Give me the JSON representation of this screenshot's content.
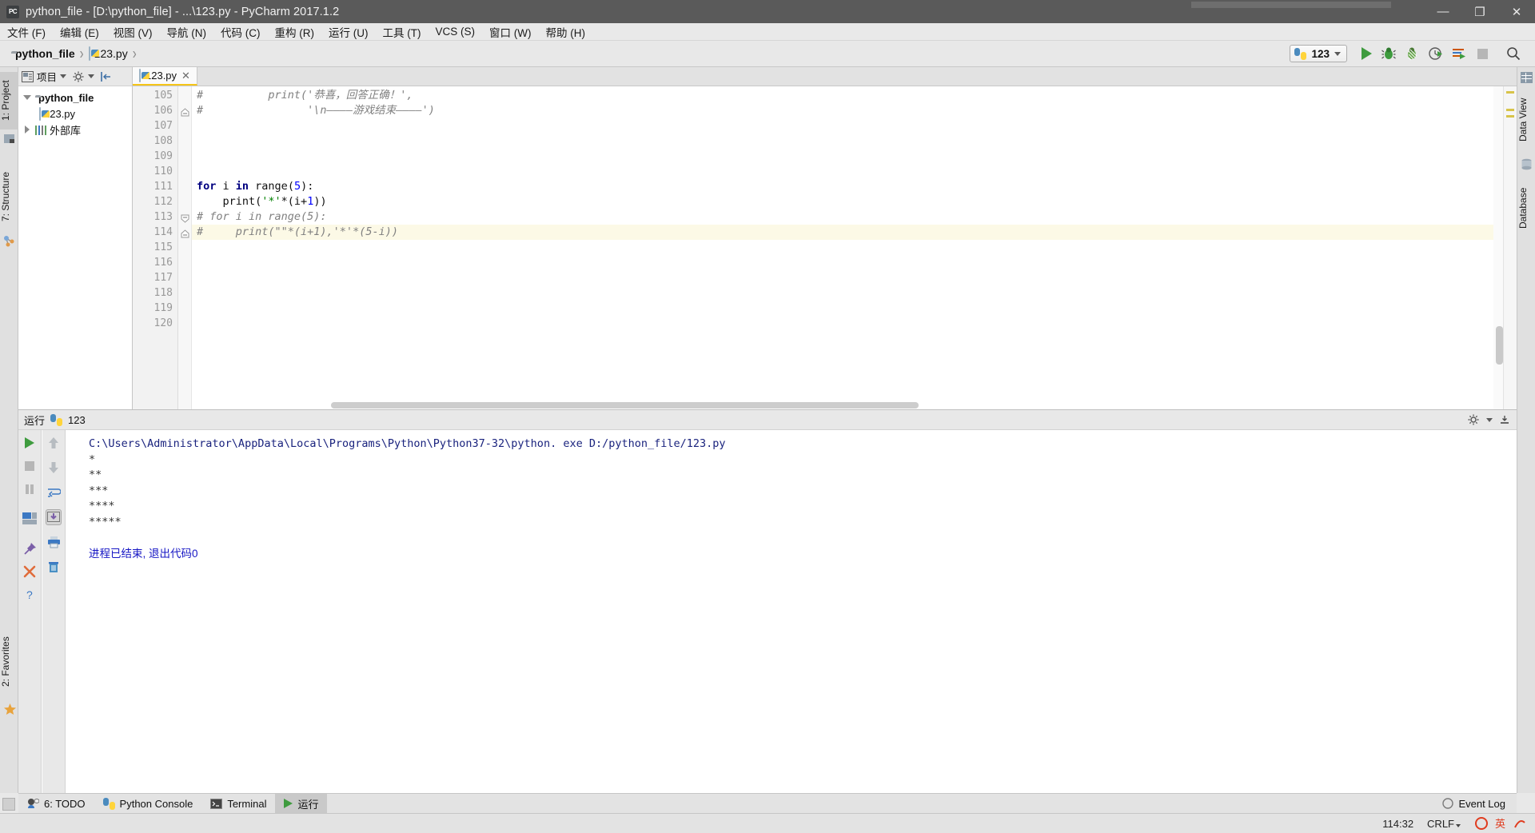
{
  "window": {
    "title": "python_file - [D:\\python_file] - ...\\123.py - PyCharm 2017.1.2",
    "app_icon": "PC",
    "minimize": "—",
    "maximize": "❐",
    "close": "✕"
  },
  "menubar": {
    "items": [
      {
        "label": "文件 (F)"
      },
      {
        "label": "编辑 (E)"
      },
      {
        "label": "视图 (V)"
      },
      {
        "label": "导航 (N)"
      },
      {
        "label": "代码 (C)"
      },
      {
        "label": "重构 (R)"
      },
      {
        "label": "运行 (U)"
      },
      {
        "label": "工具 (T)"
      },
      {
        "label": "VCS (S)"
      },
      {
        "label": "窗口 (W)"
      },
      {
        "label": "帮助 (H)"
      }
    ]
  },
  "navbar": {
    "breadcrumbs": [
      {
        "label": "python_file",
        "icon": "folder-icon"
      },
      {
        "label": "123.py",
        "icon": "python-file-icon"
      }
    ],
    "run_config": "123",
    "buttons": [
      {
        "name": "run-button",
        "title": "运行"
      },
      {
        "name": "debug-button",
        "title": "调试"
      },
      {
        "name": "coverage-button",
        "title": "覆盖率运行"
      },
      {
        "name": "profile-button",
        "title": "性能分析"
      },
      {
        "name": "run-with-console-button",
        "title": "运行控制台"
      },
      {
        "name": "stop-button",
        "title": "停止"
      },
      {
        "name": "search-everywhere-button",
        "title": "搜索"
      }
    ]
  },
  "left_strip": {
    "project": "1: Project",
    "structure": "7: Structure",
    "favorites": "2: Favorites"
  },
  "right_strip": {
    "data_view": "Data View",
    "database": "Database"
  },
  "project_panel": {
    "header_label": "项目",
    "tree": [
      {
        "label": "python_file",
        "indent": 0,
        "twisty": "down",
        "icon": "folder-icon",
        "bold": true
      },
      {
        "label": "123.py",
        "indent": 1,
        "twisty": "none",
        "icon": "python-file-icon",
        "bold": false
      },
      {
        "label": "外部库",
        "indent": 0,
        "twisty": "right",
        "icon": "library-icon",
        "bold": false
      }
    ]
  },
  "editor": {
    "tabs": [
      {
        "label": "123.py",
        "active": true,
        "close": "✕"
      }
    ],
    "highlighted_line": 114,
    "lines": [
      {
        "n": 105,
        "fold": "",
        "segments": [
          {
            "t": "#          ",
            "c": "cmt"
          },
          {
            "t": "print('恭喜，回答正确！',",
            "c": "cmt"
          }
        ]
      },
      {
        "n": 106,
        "fold": "end",
        "segments": [
          {
            "t": "#                ",
            "c": "cmt"
          },
          {
            "t": "'\\n————游戏结束————')",
            "c": "cmt"
          }
        ]
      },
      {
        "n": 107,
        "fold": "",
        "segments": []
      },
      {
        "n": 108,
        "fold": "",
        "segments": []
      },
      {
        "n": 109,
        "fold": "",
        "segments": []
      },
      {
        "n": 110,
        "fold": "",
        "segments": []
      },
      {
        "n": 111,
        "fold": "",
        "segments": [
          {
            "t": "for",
            "c": "kw"
          },
          {
            "t": " i ",
            "c": "pl"
          },
          {
            "t": "in",
            "c": "kw"
          },
          {
            "t": " range(",
            "c": "pl"
          },
          {
            "t": "5",
            "c": "num"
          },
          {
            "t": "):",
            "c": "pl"
          }
        ]
      },
      {
        "n": 112,
        "fold": "",
        "segments": [
          {
            "t": "    print(",
            "c": "pl"
          },
          {
            "t": "'*'",
            "c": "str"
          },
          {
            "t": "*(i+",
            "c": "pl"
          },
          {
            "t": "1",
            "c": "num"
          },
          {
            "t": "))",
            "c": "pl"
          }
        ]
      },
      {
        "n": 113,
        "fold": "start",
        "segments": [
          {
            "t": "# for i in range(5):",
            "c": "cmt"
          }
        ]
      },
      {
        "n": 114,
        "fold": "end",
        "segments": [
          {
            "t": "#     print(\"\"*(i+1),'*'*(5-i))",
            "c": "cmt"
          }
        ]
      },
      {
        "n": 115,
        "fold": "",
        "segments": []
      },
      {
        "n": 116,
        "fold": "",
        "segments": []
      },
      {
        "n": 117,
        "fold": "",
        "segments": []
      },
      {
        "n": 118,
        "fold": "",
        "segments": []
      },
      {
        "n": 119,
        "fold": "",
        "segments": []
      },
      {
        "n": 120,
        "fold": "",
        "segments": []
      }
    ]
  },
  "run_panel": {
    "title": "运行",
    "config_name": "123",
    "console": [
      {
        "text": "C:\\Users\\Administrator\\AppData\\Local\\Programs\\Python\\Python37-32\\python. exe D:/python_file/123.py",
        "style": "cmd"
      },
      {
        "text": "*",
        "style": "out"
      },
      {
        "text": "**",
        "style": "out"
      },
      {
        "text": "***",
        "style": "out"
      },
      {
        "text": "****",
        "style": "out"
      },
      {
        "text": "*****",
        "style": "out"
      },
      {
        "text": "",
        "style": "out"
      },
      {
        "text": "进程已结束, 退出代码0",
        "style": "exit"
      }
    ],
    "tools": [
      {
        "name": "rerun-button",
        "icon": "play-icon"
      },
      {
        "name": "stop-button",
        "icon": "stop-icon"
      },
      {
        "name": "pause-button",
        "icon": "pause-icon"
      },
      {
        "name": "restore-layout-button",
        "icon": "layout-icon"
      },
      {
        "name": "pin-tab-button",
        "icon": "pin-icon"
      },
      {
        "name": "close-button",
        "icon": "close-icon"
      },
      {
        "name": "help-button",
        "icon": "help-icon"
      }
    ],
    "tools2": [
      {
        "name": "up-stack-button",
        "icon": "arrow-up-icon"
      },
      {
        "name": "down-stack-button",
        "icon": "arrow-down-icon"
      },
      {
        "name": "soft-wrap-button",
        "icon": "wrap-icon"
      },
      {
        "name": "scroll-to-end-button",
        "icon": "scroll-end-icon"
      },
      {
        "name": "print-button",
        "icon": "print-icon"
      },
      {
        "name": "clear-all-button",
        "icon": "trash-icon"
      }
    ]
  },
  "bottom_tabs": {
    "items": [
      {
        "label": "6: TODO",
        "icon": "todo-icon",
        "active": false
      },
      {
        "label": "Python Console",
        "icon": "python-icon",
        "active": false
      },
      {
        "label": "Terminal",
        "icon": "terminal-icon",
        "active": false
      },
      {
        "label": "运行",
        "icon": "play-icon",
        "active": true
      }
    ],
    "event_log": "Event Log"
  },
  "statusbar": {
    "caret_position": "114:32",
    "line_separator": "CRLF",
    "tray_icons": [
      "ime-icon",
      "language-icon",
      "tool-icon"
    ]
  },
  "colors": {
    "accent_green": "#3e9b3e",
    "tab_underline": "#f5c518",
    "highlight_row": "#fcf9e6",
    "console_cmd": "#1a237e",
    "console_exit": "#1616c4",
    "titlebar_bg": "#5a5a5a"
  }
}
